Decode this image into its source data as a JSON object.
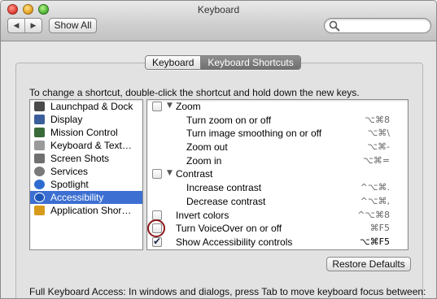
{
  "window": {
    "title": "Keyboard"
  },
  "toolbar": {
    "back": "◀",
    "forward": "▶",
    "show_all": "Show All",
    "search_placeholder": ""
  },
  "tabs": [
    {
      "label": "Keyboard",
      "active": false
    },
    {
      "label": "Keyboard Shortcuts",
      "active": true
    }
  ],
  "instructions": "To change a shortcut, double-click the shortcut and hold down the new keys.",
  "categories": [
    {
      "label": "Launchpad & Dock",
      "icon": "launchpad-icon",
      "color": "#4a4a4a"
    },
    {
      "label": "Display",
      "icon": "display-icon",
      "color": "#3a5f9a"
    },
    {
      "label": "Mission Control",
      "icon": "mission-control-icon",
      "color": "#3b6a3a"
    },
    {
      "label": "Keyboard & Text…",
      "icon": "keyboard-icon",
      "color": "#9a9a9a"
    },
    {
      "label": "Screen Shots",
      "icon": "screenshot-icon",
      "color": "#707070"
    },
    {
      "label": "Services",
      "icon": "gear-icon",
      "color": "#7a7a7a"
    },
    {
      "label": "Spotlight",
      "icon": "spotlight-icon",
      "color": "#2f6cd0"
    },
    {
      "label": "Accessibility",
      "icon": "accessibility-icon",
      "color": "#1e56b8",
      "selected": true
    },
    {
      "label": "Application Shor…",
      "icon": "app-shortcuts-icon",
      "color": "#d79a1b"
    }
  ],
  "shortcuts": [
    {
      "label": "Zoom",
      "type": "group",
      "checkbox": true,
      "checked": false,
      "key": ""
    },
    {
      "label": "Turn zoom on or off",
      "type": "item",
      "checkbox": false,
      "key": "⌥⌘8"
    },
    {
      "label": "Turn image smoothing on or off",
      "type": "item",
      "checkbox": false,
      "key": "⌥⌘\\"
    },
    {
      "label": "Zoom out",
      "type": "item",
      "checkbox": false,
      "key": "⌥⌘-"
    },
    {
      "label": "Zoom in",
      "type": "item",
      "checkbox": false,
      "key": "⌥⌘="
    },
    {
      "label": "Contrast",
      "type": "group",
      "checkbox": true,
      "checked": false,
      "key": ""
    },
    {
      "label": "Increase contrast",
      "type": "item",
      "checkbox": false,
      "key": "^⌥⌘."
    },
    {
      "label": "Decrease contrast",
      "type": "item",
      "checkbox": false,
      "key": "^⌥⌘,"
    },
    {
      "label": "Invert colors",
      "type": "top",
      "checkbox": true,
      "checked": false,
      "key": "^⌥⌘8"
    },
    {
      "label": "Turn VoiceOver on or off",
      "type": "top",
      "checkbox": true,
      "checked": false,
      "key": "⌘F5",
      "highlighted": true
    },
    {
      "label": "Show Accessibility controls",
      "type": "top",
      "checkbox": true,
      "checked": true,
      "key": "⌥⌘F5",
      "key_active": true
    }
  ],
  "restore_defaults": "Restore Defaults",
  "full_keyboard_access": "Full Keyboard Access: In windows and dialogs, press Tab to move keyboard focus between:",
  "colors": {
    "selection": "#3c6fd1",
    "highlight_ring": "#8a1a1a"
  }
}
